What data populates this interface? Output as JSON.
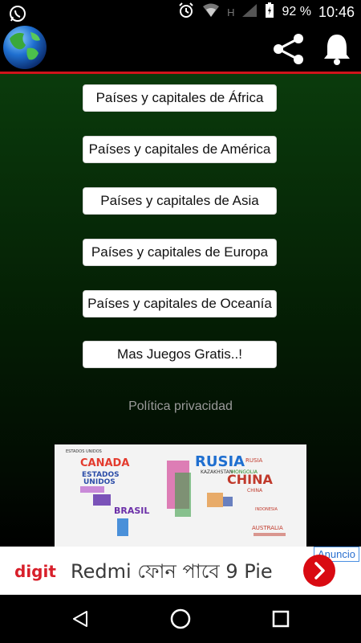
{
  "status_bar": {
    "battery_percent": "92 %",
    "time": "10:46",
    "network_letter": "H"
  },
  "menu": {
    "buttons": [
      "Países y capitales de África",
      "Países y capitales de América",
      "Países y capitales de Asia",
      "Países y capitales de Europa",
      "Países y capitales de Oceanía",
      "Mas Juegos Gratis..!"
    ],
    "privacy_link": "Política privacidad"
  },
  "wordmap": {
    "words": [
      "ESTADOS UNIDOS",
      "CANADA",
      "RUSIA",
      "CHINA",
      "BRASIL",
      "AUSTRALIA",
      "KAZAKHSTAN",
      "MONGOLIA",
      "INDONESIA"
    ]
  },
  "ad": {
    "label": "Anuncio",
    "brand": "digit",
    "text": "Redmi ফোন পাবে 9 Pie"
  },
  "colors": {
    "accent_line": "#d0141b",
    "ad_button": "#d90a12"
  }
}
